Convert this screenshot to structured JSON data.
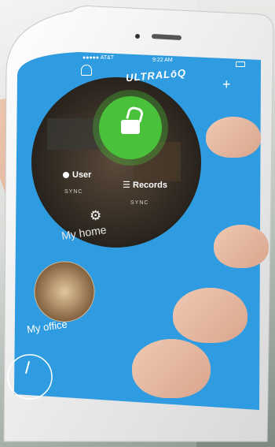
{
  "status_bar": {
    "carrier": "●●●●● AT&T",
    "time": "9:22 AM"
  },
  "header": {
    "logo": "ULTRALōQ"
  },
  "home_card": {
    "user_label": "User",
    "records_label": "Records",
    "sync_left": "SYNC",
    "sync_right": "SYNC",
    "name": "My home"
  },
  "office_card": {
    "name": "My office"
  },
  "icons": [
    "user-icon",
    "plus-icon",
    "unlock-icon",
    "user-icon",
    "list-icon",
    "gear-icon",
    "clock-icon"
  ],
  "colors": {
    "screen_blue": "#2f9be0",
    "unlock_green": "#49c13a"
  }
}
